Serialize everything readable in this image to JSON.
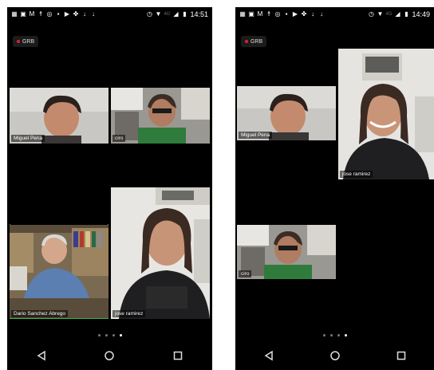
{
  "left": {
    "status": {
      "time": "14:51",
      "network": "4G"
    },
    "rec_label": "GRB",
    "participants": [
      "Miguel Pena",
      "ciro",
      "Dario Sanchez Abrego",
      "jose ramirez"
    ],
    "page": {
      "total": 4,
      "current": 4
    }
  },
  "right": {
    "status": {
      "time": "14:49",
      "network": "4G"
    },
    "rec_label": "GRB",
    "participants": [
      "Miguel Pena",
      "jose ramirez",
      "ciro"
    ],
    "page": {
      "total": 4,
      "current": 4
    }
  },
  "colors": {
    "active_speaker": "#2fb34a",
    "recording": "#e02424",
    "background": "#000000"
  }
}
